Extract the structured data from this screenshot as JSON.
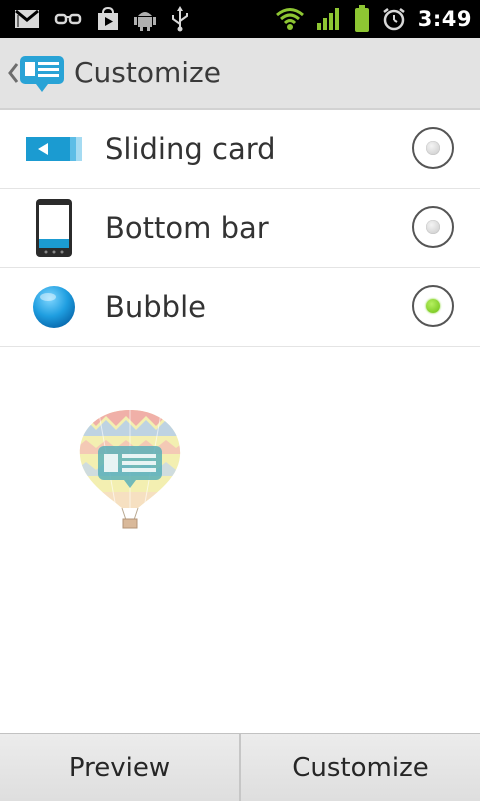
{
  "status_bar": {
    "time": "3:49",
    "left_icons": [
      "gmail-icon",
      "glasses-icon",
      "market-icon",
      "android-debug-icon",
      "usb-icon"
    ],
    "right_icons": [
      "wifi-icon",
      "signal-icon",
      "battery-icon",
      "alarm-icon"
    ],
    "accent": "#8ec633"
  },
  "action_bar": {
    "title": "Customize",
    "logo_icon": "chat-bubble-logo-icon",
    "logo_color": "#29a3d6"
  },
  "options": [
    {
      "label": "Sliding card",
      "icon": "sliding-card-icon",
      "selected": false
    },
    {
      "label": "Bottom bar",
      "icon": "phone-bottom-bar-icon",
      "selected": false
    },
    {
      "label": "Bubble",
      "icon": "blue-bubble-icon",
      "selected": true
    }
  ],
  "preview_image": "hot-air-balloon-icon",
  "buttons": {
    "preview_label": "Preview",
    "customize_label": "Customize"
  },
  "colors": {
    "selected_radio": "#7ac943",
    "brand_blue": "#1b9bd1"
  }
}
